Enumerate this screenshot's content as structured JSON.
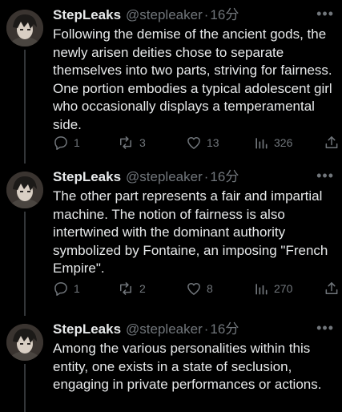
{
  "colors": {
    "background": "#000000",
    "primary_text": "#e7e9ea",
    "secondary_text": "#71767b",
    "thread_line": "#333639"
  },
  "more_icon": "more-horizontal-icon",
  "tweets": [
    {
      "name": "StepLeaks",
      "handle": "@stepleaker",
      "separator": "·",
      "time": "16分",
      "text": "Following the demise of the ancient gods, the newly arisen deities chose to separate themselves into two parts, striving for fairness. One portion embodies a typical adolescent girl who occasionally displays a temperamental side.",
      "replies": "1",
      "retweets": "3",
      "likes": "13",
      "views": "326"
    },
    {
      "name": "StepLeaks",
      "handle": "@stepleaker",
      "separator": "·",
      "time": "16分",
      "text": "The other part represents a fair and impartial machine. The notion of fairness is also intertwined with the dominant authority symbolized by Fontaine, an imposing \"French Empire\".",
      "replies": "1",
      "retweets": "2",
      "likes": "8",
      "views": "270"
    },
    {
      "name": "StepLeaks",
      "handle": "@stepleaker",
      "separator": "·",
      "time": "16分",
      "text": "Among the various personalities within this entity, one exists in a state of seclusion, engaging in private performances or actions."
    }
  ]
}
